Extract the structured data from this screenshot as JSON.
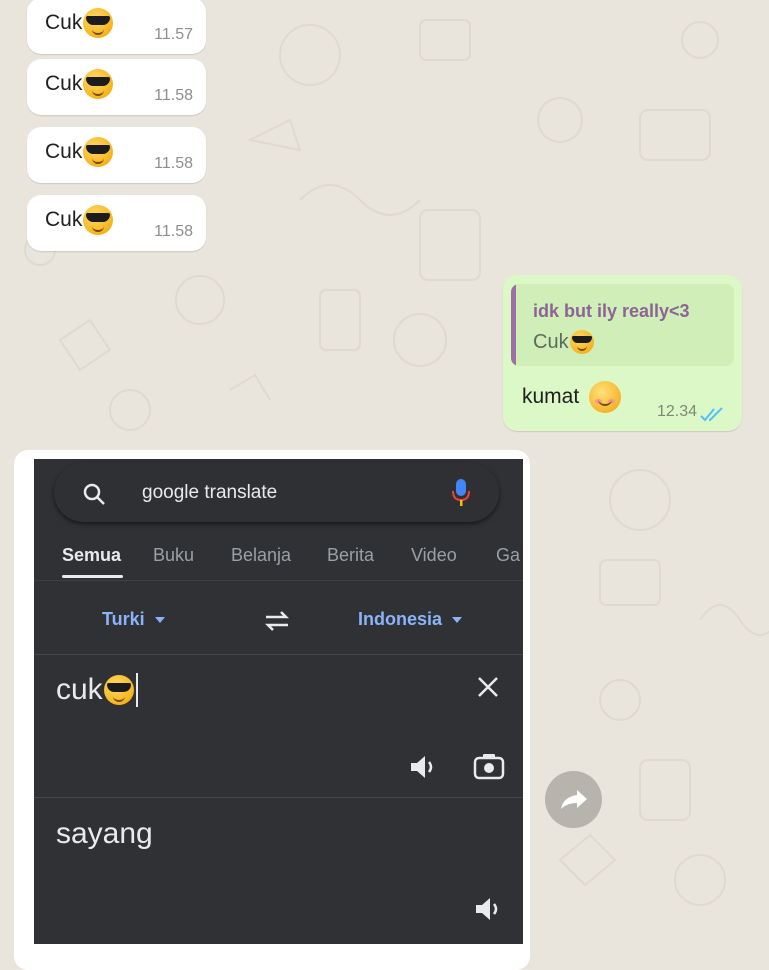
{
  "colors": {
    "chat_background": "#e9e4dc",
    "incoming_bubble": "#ffffff",
    "outgoing_bubble": "#dcf8c6",
    "quote_accent": "#9d6fa6",
    "read_ticks": "#4fc3f7",
    "google_bg": "#303134",
    "google_link": "#8ab4f8",
    "mic_blue": "#4285f4",
    "mic_red": "#ea4335"
  },
  "messages_in": [
    {
      "text": "Cuk",
      "emoji": "smiling-face-with-sunglasses-icon",
      "time": "11.57"
    },
    {
      "text": "Cuk",
      "emoji": "smiling-face-with-sunglasses-icon",
      "time": "11.58"
    },
    {
      "text": "Cuk",
      "emoji": "smiling-face-with-sunglasses-icon",
      "time": "11.58"
    },
    {
      "text": "Cuk",
      "emoji": "smiling-face-with-sunglasses-icon",
      "time": "11.58"
    }
  ],
  "message_out": {
    "quote_author": "idk but ily really<3",
    "quote_text": "Cuk",
    "text": "kumat",
    "emoji": "smiling-face-icon",
    "time": "12.34",
    "status": "read-ticks-icon"
  },
  "screenshot": {
    "search": {
      "query": "google translate"
    },
    "tabs": [
      {
        "label": "Semua",
        "active": true
      },
      {
        "label": "Buku"
      },
      {
        "label": "Belanja"
      },
      {
        "label": "Berita"
      },
      {
        "label": "Video"
      },
      {
        "label": "Ga"
      }
    ],
    "source_lang": "Turki",
    "target_lang": "Indonesia",
    "input_text": "cuk",
    "output_text": "sayang"
  }
}
